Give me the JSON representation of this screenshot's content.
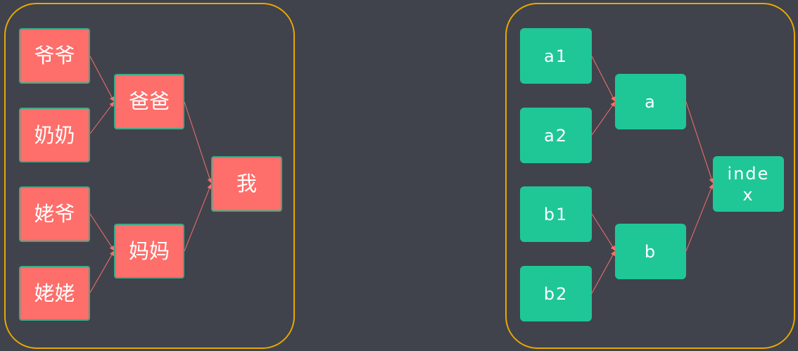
{
  "colors": {
    "background": "#40434c",
    "panel_border": "#e8a800",
    "red_node": "#fe6e6a",
    "red_node_border": "#3ba987",
    "green_node": "#1fc797",
    "edge": "#fe6e6a"
  },
  "family_tree": {
    "grandpa": "爷爷",
    "grandma": "奶奶",
    "maternal_grandpa": "姥爷",
    "maternal_grandma": "姥姥",
    "dad": "爸爸",
    "mom": "妈妈",
    "me": "我"
  },
  "module_tree": {
    "a1": "a1",
    "a2": "a2",
    "b1": "b1",
    "b2": "b2",
    "a": "a",
    "b": "b",
    "index": "inde\nx"
  }
}
